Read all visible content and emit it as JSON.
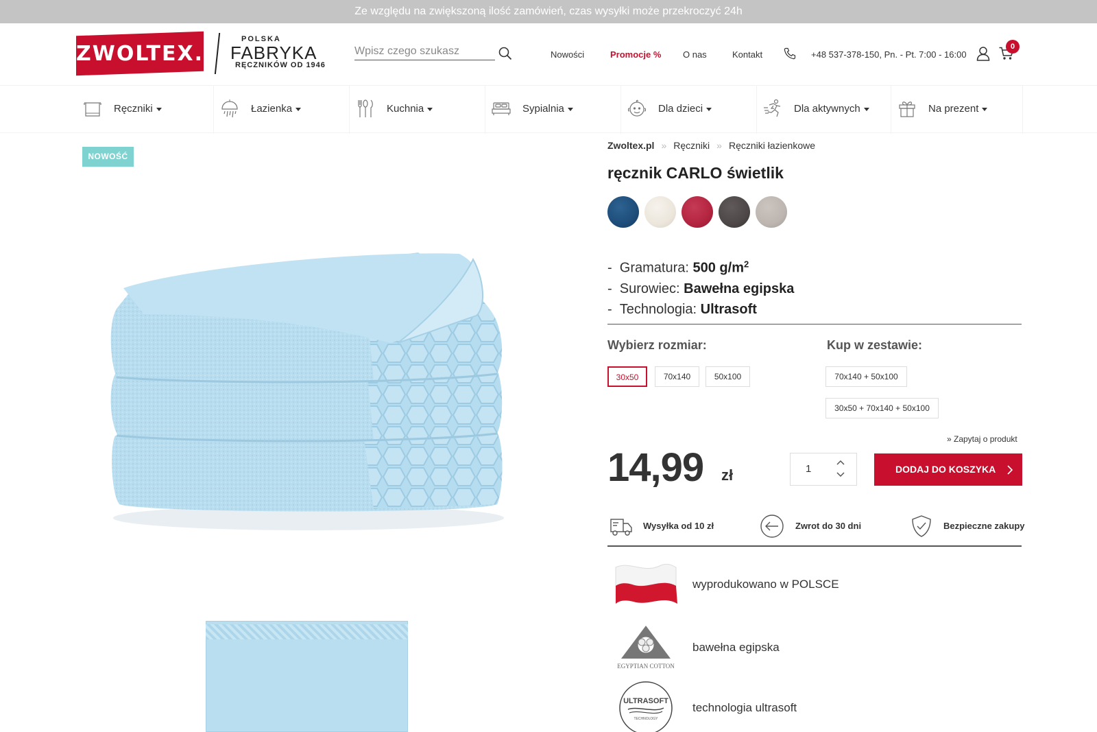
{
  "topbar": {
    "notice": "Ze względu na zwiększoną ilość zamówień, czas wysyłki może przekroczyć 24h"
  },
  "logo": {
    "brand": "ZWOLTEX.",
    "line1": "POLSKA",
    "line2": "FABRYKA",
    "line3": "RĘCZNIKÓW OD 1946"
  },
  "search": {
    "placeholder": "Wpisz czego szukasz",
    "icon": "search-icon"
  },
  "nav": {
    "links": [
      "Nowości",
      "Promocje %",
      "O nas",
      "Kontakt"
    ],
    "phone": "+48 537-378-150, Pn. - Pt. 7:00 - 16:00",
    "cart_count": "0"
  },
  "categories": [
    {
      "label": "Ręczniki",
      "icon": "towel-icon"
    },
    {
      "label": "Łazienka",
      "icon": "shower-icon"
    },
    {
      "label": "Kuchnia",
      "icon": "cutlery-icon"
    },
    {
      "label": "Sypialnia",
      "icon": "bed-icon"
    },
    {
      "label": "Dla dzieci",
      "icon": "baby-icon"
    },
    {
      "label": "Dla aktywnych",
      "icon": "runner-icon"
    },
    {
      "label": "Na prezent",
      "icon": "gift-icon"
    }
  ],
  "product": {
    "badge": "NOWOŚĆ",
    "breadcrumb": [
      "Zwoltex.pl",
      "Ręczniki",
      "Ręczniki łazienkowe"
    ],
    "breadcrumb_sep": "»",
    "title": "ręcznik CARLO świetlik",
    "swatches": [
      "#1e4d7a",
      "#ece6dc",
      "#b3243f",
      "#4d4747",
      "#bdb5b0"
    ],
    "specs": [
      {
        "label": "Gramatura:",
        "value": "500 g/m",
        "sup": "2"
      },
      {
        "label": "Surowiec:",
        "value": "Bawełna egipska"
      },
      {
        "label": "Technologia:",
        "value": "Ultrasoft"
      }
    ],
    "size_title": "Wybierz rozmiar:",
    "sizes": [
      "30x50",
      "70x140",
      "50x100"
    ],
    "selected_size": "30x50",
    "set_title": "Kup w zestawie:",
    "sets": [
      "70x140 + 50x100",
      "30x50 + 70x140 + 50x100"
    ],
    "ask": "» Zapytaj o produkt",
    "price": "14,99",
    "currency": "zł",
    "quantity": "1",
    "add_to_cart": "DODAJ DO KOSZYKA",
    "features": [
      "Wysyłka od 10 zł",
      "Zwrot do 30 dni",
      "Bezpieczne zakupy"
    ],
    "info": [
      "wyprodukowano w POLSCE",
      "bawełna egipska",
      "technologia ultrasoft"
    ],
    "info_logo_text": {
      "cotton": "EGYPTIAN COTTON",
      "ultrasoft": "ULTRASOFT",
      "ultrasoft_sub": "TECHNOLOGY"
    }
  },
  "colors": {
    "accent": "#c8102e",
    "badge": "#7ed3d0",
    "towel": "#b9def0"
  }
}
